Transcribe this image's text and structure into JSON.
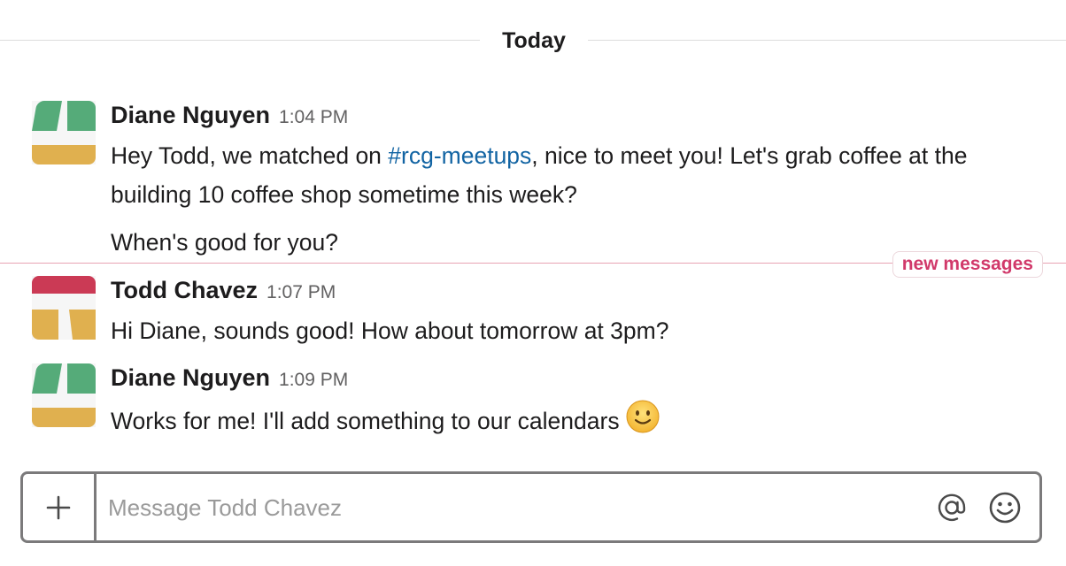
{
  "day_divider": {
    "label": "Today"
  },
  "messages": [
    {
      "sender": "Diane Nguyen",
      "time": "1:04 PM",
      "line1_prefix": "Hey Todd, we matched on ",
      "channel": "#rcg-meetups",
      "line1_suffix": ", nice to meet you! Let's grab coffee at the building 10 coffee shop sometime this week?",
      "line2": "When's good for you?"
    },
    {
      "sender": "Todd Chavez",
      "time": "1:07 PM",
      "text": "Hi Diane, sounds good! How about tomorrow at 3pm?"
    },
    {
      "sender": "Diane Nguyen",
      "time": "1:09 PM",
      "text": "Works for me! I'll add something to our calendars",
      "emoji": "slightly-smiling-face-emoji"
    }
  ],
  "new_messages_divider": {
    "label": "new messages"
  },
  "composer": {
    "placeholder": "Message Todd Chavez",
    "value": "",
    "icons": [
      "plus-icon",
      "at-sign-icon",
      "smiley-icon"
    ]
  },
  "colors": {
    "green": "#55ab79",
    "gold": "#e0b04f",
    "red": "#cb3a55",
    "link": "#1264a3",
    "new_messages": "#d1396a"
  }
}
